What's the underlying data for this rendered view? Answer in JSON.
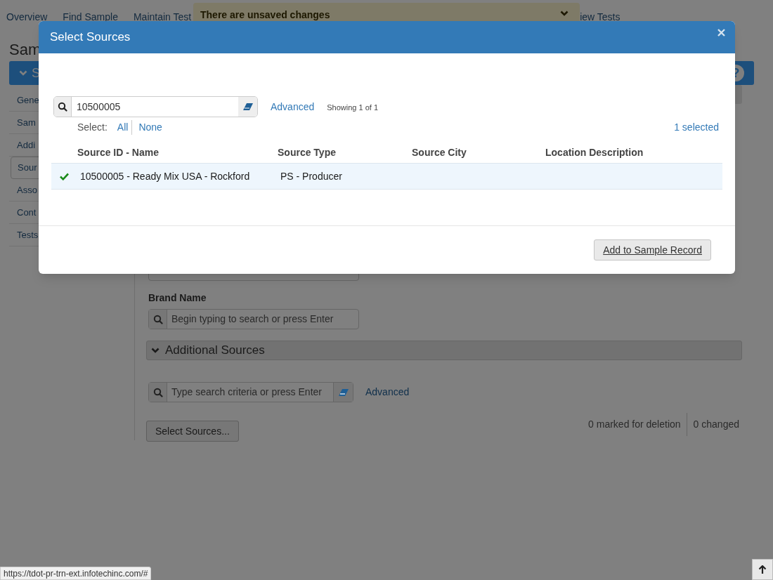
{
  "page": {
    "nav": [
      {
        "label": "Overview"
      },
      {
        "label": "Find Sample"
      },
      {
        "label": "Maintain Test"
      },
      {
        "label": "iew Tests"
      }
    ],
    "unsaved_banner": "There are unsaved changes",
    "title": "Sam",
    "section_header": {
      "label": "S",
      "expanded": true,
      "help": "?"
    },
    "sidebar": {
      "items": [
        {
          "label": "Gene",
          "selected": false
        },
        {
          "label": "Sam",
          "selected": false
        },
        {
          "label": "Addi",
          "selected": false
        },
        {
          "label": "Sour",
          "selected": true
        },
        {
          "label": "Asso",
          "selected": false
        },
        {
          "label": "Cont",
          "selected": false
        },
        {
          "label": "Tests",
          "selected": false
        }
      ]
    },
    "brand_name": {
      "label": "Brand Name",
      "placeholder": "Begin typing to search or press Enter"
    },
    "additional_sources": {
      "title": "Additional Sources",
      "expanded": true,
      "search_placeholder": "Type search criteria or press Enter",
      "advanced": "Advanced",
      "select_button": "Select Sources...",
      "marked_for_deletion": "0 marked for deletion",
      "changed": "0 changed"
    }
  },
  "dialog": {
    "title": "Select Sources",
    "search_value": "10500005",
    "advanced": "Advanced",
    "showing": "Showing 1 of 1",
    "select_label": "Select:",
    "select_all": "All",
    "select_none": "None",
    "selected_count": "1 selected",
    "table": {
      "columns": [
        "Source ID - Name",
        "Source Type",
        "Source City",
        "Location Description"
      ],
      "rows": [
        {
          "selected": true,
          "source_id_name": "10500005 - Ready Mix USA - Rockford",
          "source_type": "PS - Producer"
        }
      ]
    },
    "add_button": "Add to Sample Record"
  },
  "status_url": "https://tdot-pr-trn-ext.infotechinc.com/#"
}
